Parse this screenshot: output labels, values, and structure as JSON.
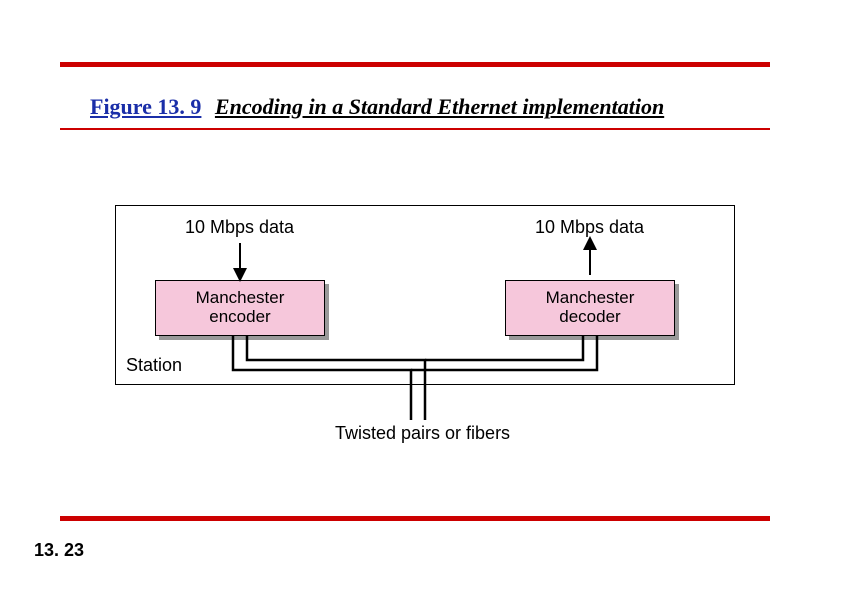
{
  "figure": {
    "label": "Figure 13. 9",
    "caption": "Encoding in a Standard Ethernet implementation"
  },
  "page_number": "13. 23",
  "diagram": {
    "station_label": "Station",
    "left_data_label": "10 Mbps data",
    "right_data_label": "10 Mbps data",
    "encoder_label": "Manchester\nencoder",
    "decoder_label": "Manchester\ndecoder",
    "medium_label": "Twisted pairs or fibers"
  }
}
